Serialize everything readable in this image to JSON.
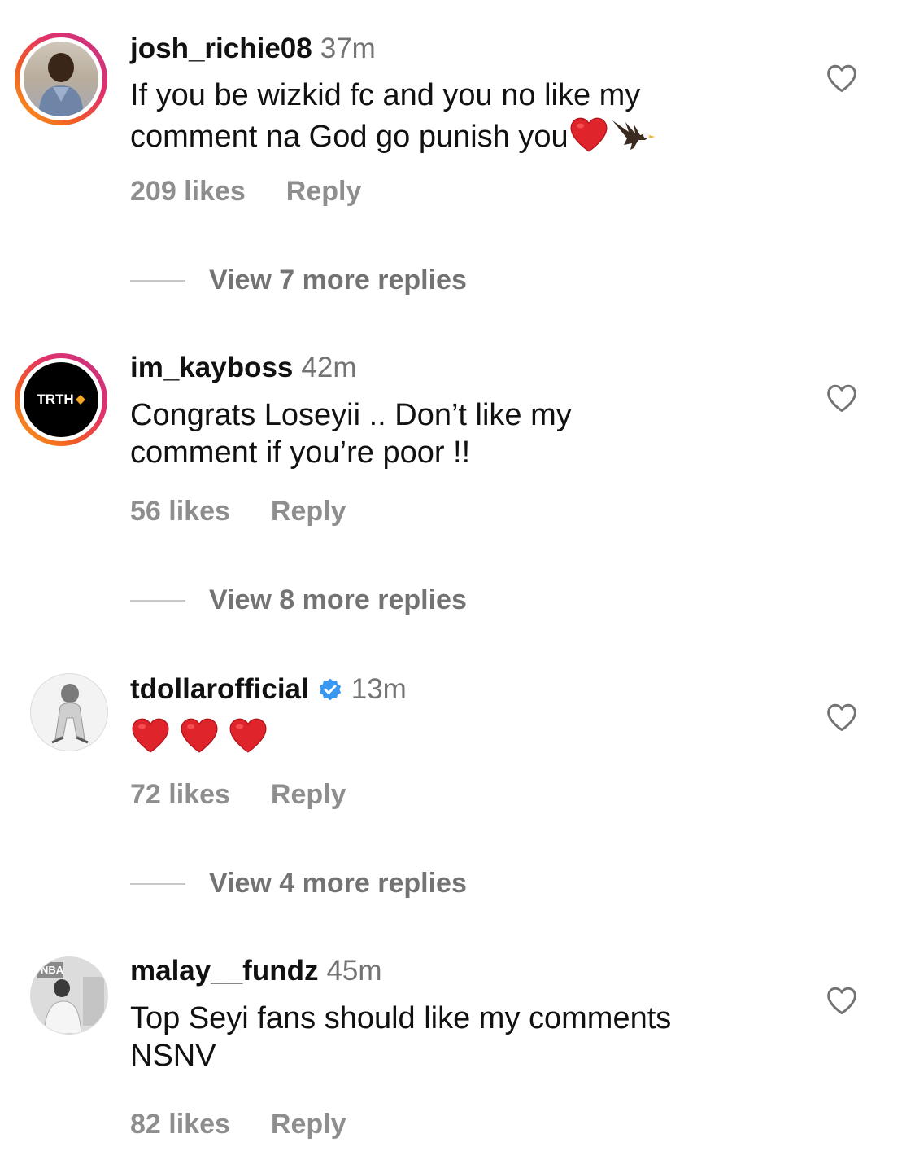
{
  "comments": [
    {
      "username": "josh_richie08",
      "time": "37m",
      "text_line1": "If you be wizkid fc and you no like my",
      "text_line2": "comment na God go punish you",
      "likes": "209 likes",
      "reply": "Reply",
      "view_replies": "View 7 more replies",
      "emojis": [
        "red-heart",
        "eagle"
      ]
    },
    {
      "username": "im_kayboss",
      "time": "42m",
      "avatar_text": "TRTH",
      "text_line1": "Congrats Loseyii .. Don’t like my",
      "text_line2": "comment if you’re poor !!",
      "likes": "56 likes",
      "reply": "Reply",
      "view_replies": "View 8 more replies"
    },
    {
      "username": "tdollarofficial",
      "verified": true,
      "time": "13m",
      "emojis": [
        "red-heart",
        "red-heart",
        "red-heart"
      ],
      "likes": "72 likes",
      "reply": "Reply",
      "view_replies": "View 4 more replies"
    },
    {
      "username": "malay__fundz",
      "time": "45m",
      "avatar_text": "NBA",
      "text_line1": "Top Seyi fans should like my comments",
      "text_line2": "NSNV",
      "likes": "82 likes",
      "reply": "Reply"
    }
  ],
  "colors": {
    "verified_blue": "#3897f0",
    "heart_red": "#e0242b",
    "meta_gray": "#8e8e8e",
    "time_gray": "#737373"
  }
}
